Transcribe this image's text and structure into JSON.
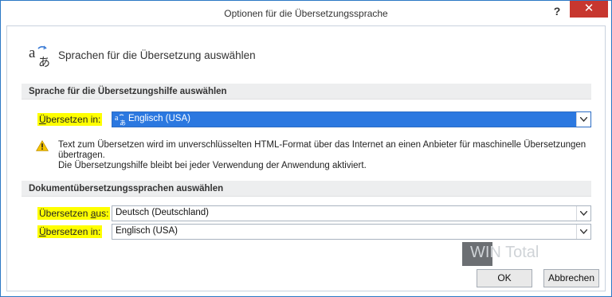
{
  "window": {
    "title": "Optionen für die Übersetzungssprache",
    "help_glyph": "?",
    "close_glyph": "✕"
  },
  "header": {
    "heading": "Sprachen für die Übersetzung auswählen",
    "icon": "translate-icon"
  },
  "section_helper": {
    "title": "Sprache für die Übersetzungshilfe auswählen",
    "label_prefix": "Ü",
    "label_rest": "bersetzen in:",
    "selected_value": "Englisch (USA)",
    "selected_icon": "translate-icon"
  },
  "warning": {
    "icon": "warning-icon",
    "line1": "Text zum Übersetzen wird im unverschlüsselten HTML-Format über das Internet an einen Anbieter für maschinelle Übersetzungen übertragen.",
    "line2": "Die Übersetzungshilfe bleibt bei jeder Verwendung der Anwendung aktiviert."
  },
  "section_document": {
    "title": "Dokumentübersetzungssprachen auswählen",
    "from_label_pre": "Übersetzen ",
    "from_label_ul": "a",
    "from_label_post": "us:",
    "from_value": "Deutsch (Deutschland)",
    "to_label_pre": "",
    "to_label_ul": "Ü",
    "to_label_post": "bersetzen in:",
    "to_value": "Englisch (USA)"
  },
  "buttons": {
    "ok": "OK",
    "cancel": "Abbrechen"
  },
  "watermark": {
    "text": "WIN Total"
  },
  "colors": {
    "highlight": "#ffff00",
    "selection": "#2b78e0",
    "close": "#c7372f"
  }
}
